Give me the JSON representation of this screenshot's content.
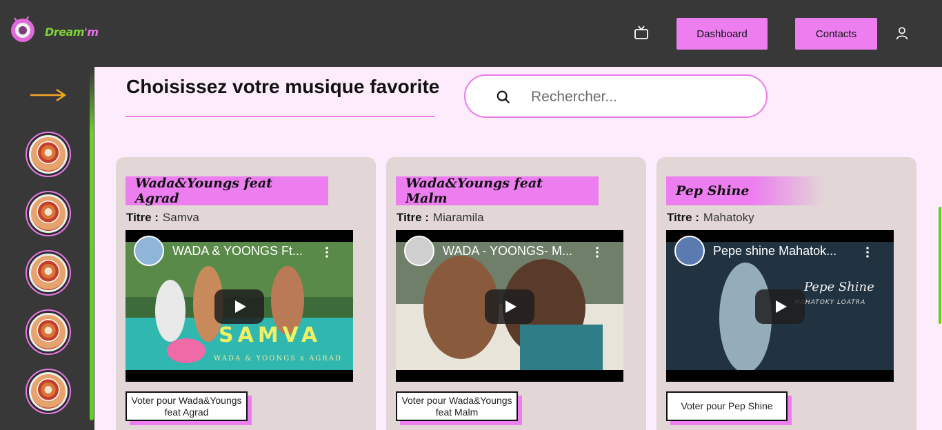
{
  "brand": {
    "name_part1": "Dream",
    "name_part2": "'m"
  },
  "nav": {
    "dashboard_label": "Dashboard",
    "contacts_label": "Contacts",
    "tv_icon": "tv-icon",
    "user_icon": "user-icon"
  },
  "sidebar": {
    "toggle_icon": "arrow-right-icon",
    "avatars": [
      {
        "name": "album-avatar-1"
      },
      {
        "name": "album-avatar-2"
      },
      {
        "name": "album-avatar-3"
      },
      {
        "name": "album-avatar-4"
      },
      {
        "name": "album-avatar-5"
      }
    ]
  },
  "main": {
    "heading": "Choisissez votre musique favorite",
    "search": {
      "placeholder": "Rechercher..."
    }
  },
  "cards": [
    {
      "artist": "Wada&Youngs feat Agrad",
      "title_label": "Titre :",
      "title": "Samva",
      "video_title": "WADA & YOONGS Ft...",
      "overlay_word": "SAMVA",
      "overlay_sub": "WADA & YOONGS x AGRAD",
      "vote_label": "Voter pour Wada&Youngs feat Agrad"
    },
    {
      "artist": "Wada&Youngs feat Malm",
      "title_label": "Titre :",
      "title": "Miaramila",
      "video_title": "WADA - YOONGS- M...",
      "vote_label": "Voter pour Wada&Youngs feat Malm"
    },
    {
      "artist": "Pep Shine",
      "title_label": "Titre :",
      "title": "Mahatoky",
      "video_title": "Pepe shine Mahatok...",
      "overlay_script": "Pepe Shine",
      "overlay_script2": "MAHATOKY LOATRA",
      "vote_label": "Voter pour Pep Shine"
    }
  ],
  "colors": {
    "accent_pink": "#ec7ef0",
    "accent_green": "#5bd31f",
    "background": "#fdecfb",
    "card": "#e3d6d6"
  }
}
